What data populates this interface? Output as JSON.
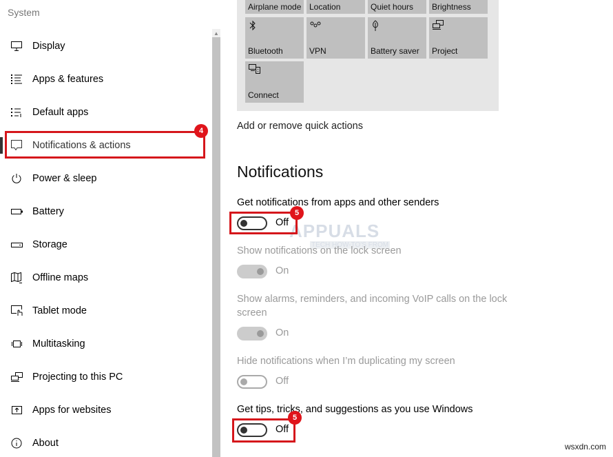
{
  "sidebar": {
    "title": "System",
    "items": [
      {
        "label": "Display",
        "icon": "monitor-icon"
      },
      {
        "label": "Apps & features",
        "icon": "list-icon"
      },
      {
        "label": "Default apps",
        "icon": "default-apps-icon"
      },
      {
        "label": "Notifications & actions",
        "icon": "speech-bubble-icon",
        "selected": true
      },
      {
        "label": "Power & sleep",
        "icon": "power-icon"
      },
      {
        "label": "Battery",
        "icon": "battery-icon"
      },
      {
        "label": "Storage",
        "icon": "storage-drive-icon"
      },
      {
        "label": "Offline maps",
        "icon": "map-download-icon"
      },
      {
        "label": "Tablet mode",
        "icon": "tablet-touch-icon"
      },
      {
        "label": "Multitasking",
        "icon": "multitasking-icon"
      },
      {
        "label": "Projecting to this PC",
        "icon": "projecting-icon"
      },
      {
        "label": "Apps for websites",
        "icon": "app-website-icon"
      },
      {
        "label": "About",
        "icon": "info-icon"
      }
    ]
  },
  "quick_actions": {
    "tiles": [
      {
        "label": "Airplane mode",
        "icon": ""
      },
      {
        "label": "Location",
        "icon": ""
      },
      {
        "label": "Quiet hours",
        "icon": ""
      },
      {
        "label": "Brightness",
        "icon": ""
      },
      {
        "label": "Bluetooth",
        "icon": "bluetooth-icon"
      },
      {
        "label": "VPN",
        "icon": "vpn-icon"
      },
      {
        "label": "Battery saver",
        "icon": "battery-saver-leaf-icon"
      },
      {
        "label": "Project",
        "icon": "project-icon"
      },
      {
        "label": "Connect",
        "icon": "connect-icon"
      }
    ],
    "link": "Add or remove quick actions"
  },
  "notifications": {
    "title": "Notifications",
    "settings": [
      {
        "label": "Get notifications from apps and other senders",
        "state": "Off",
        "enabled": true
      },
      {
        "label": "Show notifications on the lock screen",
        "state": "On",
        "enabled": false
      },
      {
        "label": "Show alarms, reminders, and incoming VoIP calls on the lock screen",
        "state": "On",
        "enabled": false
      },
      {
        "label": "Hide notifications when I’m duplicating my screen",
        "state": "Off",
        "enabled": false
      },
      {
        "label": "Get tips, tricks, and suggestions as you use Windows",
        "state": "Off",
        "enabled": true
      }
    ]
  },
  "annotations": {
    "step4": "4",
    "step5a": "5",
    "step5b": "5",
    "color": "#d5161b"
  },
  "watermarks": {
    "logo_text": "APPUALS",
    "logo_sub": "TECH HOW-TO'S FROM",
    "site": "wsxdn.com"
  }
}
